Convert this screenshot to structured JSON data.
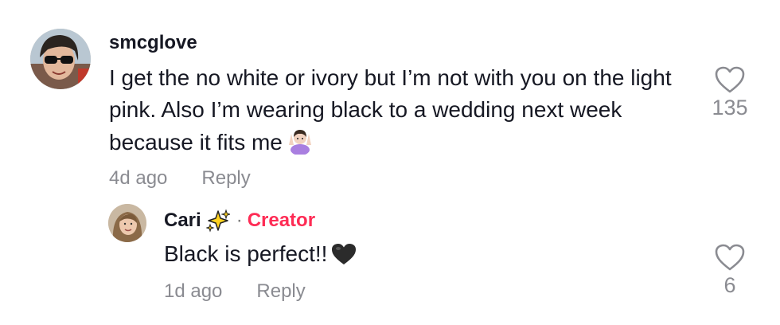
{
  "comment": {
    "username": "smcglove",
    "text": "I get the no white or ivory but I’m not with you on the light pink. Also I’m wearing black to a wedding next week because it fits me",
    "emoji": "🤷‍♀️",
    "time": "4d ago",
    "reply_label": "Reply",
    "likes": "135"
  },
  "reply": {
    "username": "Cari",
    "separator": "·",
    "creator_label": "Creator",
    "text": "Black is perfect!!",
    "emoji": "🖤",
    "time": "1d ago",
    "reply_label": "Reply",
    "likes": "6"
  },
  "colors": {
    "text": "#161823",
    "secondary": "#8a8b91",
    "creator": "#fe2c55"
  },
  "icons": {
    "like": "heart-outline-icon",
    "sparkle": "sparkles-icon"
  }
}
